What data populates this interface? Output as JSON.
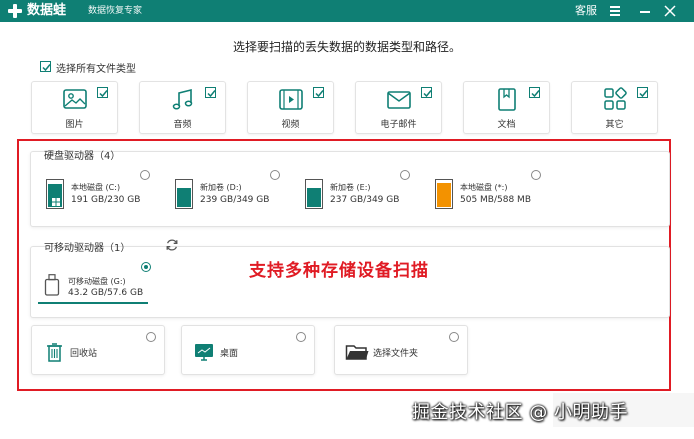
{
  "window": {
    "app_name": "数据蛙",
    "app_subtitle": "数据恢复专家",
    "service_label": "客服",
    "brand_color": "#0f7f74",
    "logo_icon": "cross-logo-icon"
  },
  "main": {
    "heading": "选择要扫描的丢失数据的数据类型和路径。",
    "select_all_label": "选择所有文件类型",
    "select_all_checked": true
  },
  "file_types": [
    {
      "label": "图片",
      "icon": "image-icon",
      "checked": true
    },
    {
      "label": "音频",
      "icon": "music-icon",
      "checked": true
    },
    {
      "label": "视频",
      "icon": "video-icon",
      "checked": true
    },
    {
      "label": "电子邮件",
      "icon": "email-icon",
      "checked": true
    },
    {
      "label": "文档",
      "icon": "document-icon",
      "checked": true
    },
    {
      "label": "其它",
      "icon": "other-icon",
      "checked": true
    }
  ],
  "hard_drives": {
    "title": "硬盘驱动器（4）",
    "drives": [
      {
        "name": "本地磁盘 (C:)",
        "size": "191 GB/230 GB",
        "used_fraction": 0.83,
        "fill_color": "#0f7f74",
        "icon": "windows-drive-icon",
        "selected": false
      },
      {
        "name": "新加卷 (D:)",
        "size": "239 GB/349 GB",
        "used_fraction": 0.68,
        "fill_color": "#0f7f74",
        "icon": "drive-icon",
        "selected": false
      },
      {
        "name": "新加卷 (E:)",
        "size": "237 GB/349 GB",
        "used_fraction": 0.68,
        "fill_color": "#0f7f74",
        "icon": "drive-icon",
        "selected": false
      },
      {
        "name": "本地磁盘 (*:)",
        "size": "505 MB/588 MB",
        "used_fraction": 0.86,
        "fill_color": "#f39200",
        "icon": "drive-icon",
        "selected": false
      }
    ]
  },
  "removable_drives": {
    "title": "可移动驱动器（1）",
    "refresh_icon": "refresh-icon",
    "drives": [
      {
        "name": "可移动磁盘 (G:)",
        "size": "43.2 GB/57.6 GB",
        "icon": "usb-drive-icon",
        "selected": true
      }
    ]
  },
  "promo_text": "支持多种存储设备扫描",
  "promo_color": "#e01b24",
  "locations": [
    {
      "label": "回收站",
      "icon": "recycle-bin-icon",
      "selected": false
    },
    {
      "label": "桌面",
      "icon": "desktop-icon",
      "selected": false
    },
    {
      "label": "选择文件夹",
      "icon": "folder-icon",
      "selected": false
    }
  ],
  "watermark": "掘金技术社区 @ 小明助手"
}
